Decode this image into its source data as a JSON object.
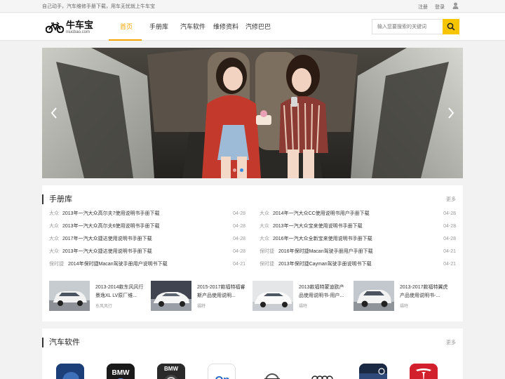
{
  "topbar": {
    "slogan": "自己动手，汽车维修手册下载，用车无忧就上牛车宝",
    "register": "注册",
    "login": "登录"
  },
  "logo": {
    "brand": "牛车宝",
    "domain": "niucbao.com"
  },
  "nav": [
    "首页",
    "手册库",
    "汽车软件",
    "维修资料",
    "汽修巴巴"
  ],
  "search": {
    "placeholder": "输入您要搜索的关键词"
  },
  "manuals": {
    "title": "手册库",
    "more": "更多",
    "left": [
      {
        "brand": "大众",
        "title": "2013年一汽大众高尔夫7使用说明书手册下载",
        "date": "04-28"
      },
      {
        "brand": "大众",
        "title": "2013年一汽大众高尔夫6使用说明书手册下载",
        "date": "04-28"
      },
      {
        "brand": "大众",
        "title": "2017年一汽大众捷达使用说明书手册下载",
        "date": "04-28"
      },
      {
        "brand": "大众",
        "title": "2013年一汽大众捷达使用说明书手册下载",
        "date": "04-28"
      },
      {
        "brand": "保时捷",
        "title": "2014年保时捷Macan驾驶手册用户说明书下载",
        "date": "04-21"
      }
    ],
    "right": [
      {
        "brand": "大众",
        "title": "2014年一汽大众CC使用说明书用户手册下载",
        "date": "04-28"
      },
      {
        "brand": "大众",
        "title": "2013年一汽大众宝来使用说明书手册下载",
        "date": "04-28"
      },
      {
        "brand": "大众",
        "title": "2016年一汽大众全新宝来使用说明书手册下载",
        "date": "04-28"
      },
      {
        "brand": "保时捷",
        "title": "2016年保时捷Macan驾驶手册用户手册下载",
        "date": "04-21"
      },
      {
        "brand": "保时捷",
        "title": "2013年保时捷Cayman驾驶手册说明书下载",
        "date": "04-21"
      }
    ],
    "cards": [
      {
        "title": "2013-2014款东风风行景逸XL LV原厂维...",
        "brand": "东风风行"
      },
      {
        "title": "2015-2017款福特福睿斯产品使用说明...",
        "brand": "福特"
      },
      {
        "title": "2013款福特蒙迪欧产品使用说明书-用户...",
        "brand": "福特"
      },
      {
        "title": "2013-2017款福特翼虎产品使用说明书-...",
        "brand": "福特"
      }
    ]
  },
  "software": {
    "title": "汽车软件",
    "more": "更多",
    "apps": [
      {
        "icon": "ford-app-icon",
        "color": "#1c3f7a"
      },
      {
        "icon": "bmw-app-icon",
        "color": "#1a1a1a"
      },
      {
        "icon": "bmw-connected-app-icon",
        "color": "#2a2a2a"
      },
      {
        "icon": "onstar-app-icon",
        "color": "#ffffff"
      },
      {
        "icon": "volvo-app-icon",
        "color": "#ffffff"
      },
      {
        "icon": "audi-app-icon",
        "color": "#ffffff"
      },
      {
        "icon": "volkswagen-app-icon",
        "color": "#1b2a44"
      },
      {
        "icon": "tesla-app-icon",
        "color": "#d11f2c"
      }
    ]
  },
  "colors": {
    "accent": "#f5a400",
    "search_button": "#f7c500",
    "active_dot": "#3a8ee6"
  }
}
